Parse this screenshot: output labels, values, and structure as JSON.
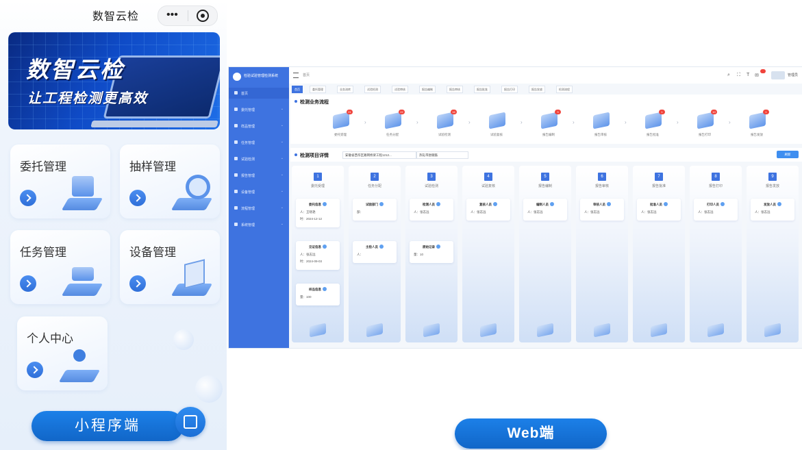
{
  "mobile": {
    "title": "数智云检",
    "banner": {
      "title": "数智云检",
      "slogan": "让工程检测更高效"
    },
    "cards": [
      {
        "label": "委托管理",
        "icon": "monitor-icon"
      },
      {
        "label": "抽样管理",
        "icon": "magnifier-icon"
      },
      {
        "label": "任务管理",
        "icon": "task-stack-icon"
      },
      {
        "label": "设备管理",
        "icon": "device-pages-icon"
      },
      {
        "label": "个人中心",
        "icon": "user-center-icon"
      }
    ],
    "button": "小程序端"
  },
  "web": {
    "sidebar": {
      "brand": "检验试验管理检测系统",
      "items": [
        "首页",
        "委托管理",
        "样品管理",
        "任务管理",
        "试验检测",
        "报告管理",
        "设备管理",
        "流程管理",
        "系统管理"
      ]
    },
    "topbar": {
      "crumb": "首页",
      "user": "管理员",
      "badge": "62"
    },
    "tabs": [
      "首页",
      "委托管理",
      "业务流转",
      "试验检测",
      "试验审核",
      "报告编制",
      "报告审核",
      "报告批准",
      "报告打印",
      "报告发放",
      "检测流程"
    ],
    "flow": {
      "title": "检测业务流程",
      "steps": [
        {
          "label": "委托受理",
          "count": "21"
        },
        {
          "label": "任务分配",
          "count": "22"
        },
        {
          "label": "试验检测",
          "count": "16"
        },
        {
          "label": "试验复核",
          "count": ""
        },
        {
          "label": "报告编制",
          "count": "3"
        },
        {
          "label": "报告审核",
          "count": ""
        },
        {
          "label": "报告批准",
          "count": "1"
        },
        {
          "label": "报告打印",
          "count": "10"
        },
        {
          "label": "报告发放",
          "count": "1"
        }
      ]
    },
    "detail": {
      "title": "检测项目详情",
      "project": "安徽省西华区路网桥梁工程1212...",
      "item": "热轧带肋钢筋",
      "button": "刷新",
      "columns": [
        {
          "idx": "1",
          "title": "委托受理",
          "cards": [
            {
              "head": "委托信息",
              "lines": [
                "人：王晓艳",
                "时：2024-12-12"
              ]
            },
            {
              "head": "见证信息",
              "lines": [
                "人：张志远",
                "时：2024-09-03"
              ]
            },
            {
              "head": "样品信息",
              "lines": [
                "量：100"
              ]
            }
          ]
        },
        {
          "idx": "2",
          "title": "任务分配",
          "cards": [
            {
              "head": "试验部门",
              "lines": [
                "部："
              ]
            },
            {
              "head": "主检人员",
              "lines": [
                "人："
              ]
            }
          ]
        },
        {
          "idx": "3",
          "title": "试验检测",
          "cards": [
            {
              "head": "检测人员",
              "lines": [
                "人：张志远"
              ]
            },
            {
              "head": "原始记录",
              "lines": [
                "量：10"
              ]
            }
          ]
        },
        {
          "idx": "4",
          "title": "试验复核",
          "cards": [
            {
              "head": "复核人员",
              "lines": [
                "人：张志远"
              ]
            }
          ]
        },
        {
          "idx": "5",
          "title": "报告编制",
          "cards": [
            {
              "head": "编制人员",
              "lines": [
                "人：张志远"
              ]
            }
          ]
        },
        {
          "idx": "6",
          "title": "报告审核",
          "cards": [
            {
              "head": "审核人员",
              "lines": [
                "人：张志远"
              ]
            }
          ]
        },
        {
          "idx": "7",
          "title": "报告批准",
          "cards": [
            {
              "head": "批准人员",
              "lines": [
                "人：张志远"
              ]
            }
          ]
        },
        {
          "idx": "8",
          "title": "报告打印",
          "cards": [
            {
              "head": "打印人员",
              "lines": [
                "人：张志远"
              ]
            }
          ]
        },
        {
          "idx": "9",
          "title": "报告发放",
          "cards": [
            {
              "head": "发放人员",
              "lines": [
                "人：张志远"
              ]
            }
          ]
        }
      ]
    },
    "button": "Web端"
  }
}
